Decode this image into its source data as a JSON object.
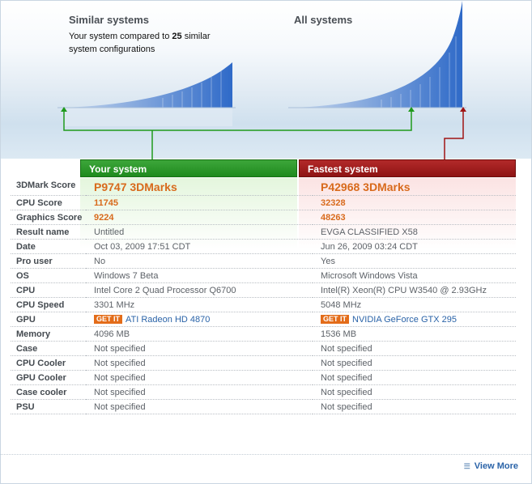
{
  "similar": {
    "title": "Similar systems",
    "subtitle_pre": "Your system compared to",
    "count": "25",
    "subtitle_post": "similar system configurations"
  },
  "all": {
    "title": "All systems"
  },
  "headers": {
    "your": "Your system",
    "fastest": "Fastest system"
  },
  "rows": [
    {
      "label": "3DMark Score",
      "your": "P9747 3DMarks",
      "fastest": "P42968 3DMarks",
      "style": "score"
    },
    {
      "label": "CPU Score",
      "your": "11745",
      "fastest": "32328",
      "style": "sub"
    },
    {
      "label": "Graphics Score",
      "your": "9224",
      "fastest": "48263",
      "style": "sub"
    },
    {
      "label": "Result name",
      "your": "Untitled",
      "fastest": "EVGA CLASSIFIED X58"
    },
    {
      "label": "Date",
      "your": "Oct 03, 2009 17:51 CDT",
      "fastest": "Jun 26, 2009 03:24 CDT"
    },
    {
      "label": "Pro user",
      "your": "No",
      "fastest": "Yes"
    },
    {
      "label": "OS",
      "your": "Windows 7 Beta",
      "fastest": "Microsoft Windows Vista"
    },
    {
      "label": "CPU",
      "your": "Intel Core 2 Quad Processor Q6700",
      "fastest": "Intel(R) Xeon(R) CPU W3540 @ 2.93GHz"
    },
    {
      "label": "CPU Speed",
      "your": "3301 MHz",
      "fastest": "5048 MHz"
    },
    {
      "label": "GPU",
      "your": "ATI Radeon HD 4870",
      "fastest": "NVIDIA GeForce GTX 295",
      "style": "gpu"
    },
    {
      "label": "Memory",
      "your": "4096 MB",
      "fastest": "1536 MB"
    },
    {
      "label": "Case",
      "your": "Not specified",
      "fastest": "Not specified"
    },
    {
      "label": "CPU Cooler",
      "your": "Not specified",
      "fastest": "Not specified"
    },
    {
      "label": "GPU Cooler",
      "your": "Not specified",
      "fastest": "Not specified"
    },
    {
      "label": "Case cooler",
      "your": "Not specified",
      "fastest": "Not specified"
    },
    {
      "label": "PSU",
      "your": "Not specified",
      "fastest": "Not specified"
    }
  ],
  "getit_label": "GET IT",
  "view_more": "View More",
  "colors": {
    "your": "#1f8a1e",
    "fastest": "#8e1313",
    "score": "#d86a1c",
    "link": "#2a63a8",
    "curve": "#3a6fc4"
  }
}
